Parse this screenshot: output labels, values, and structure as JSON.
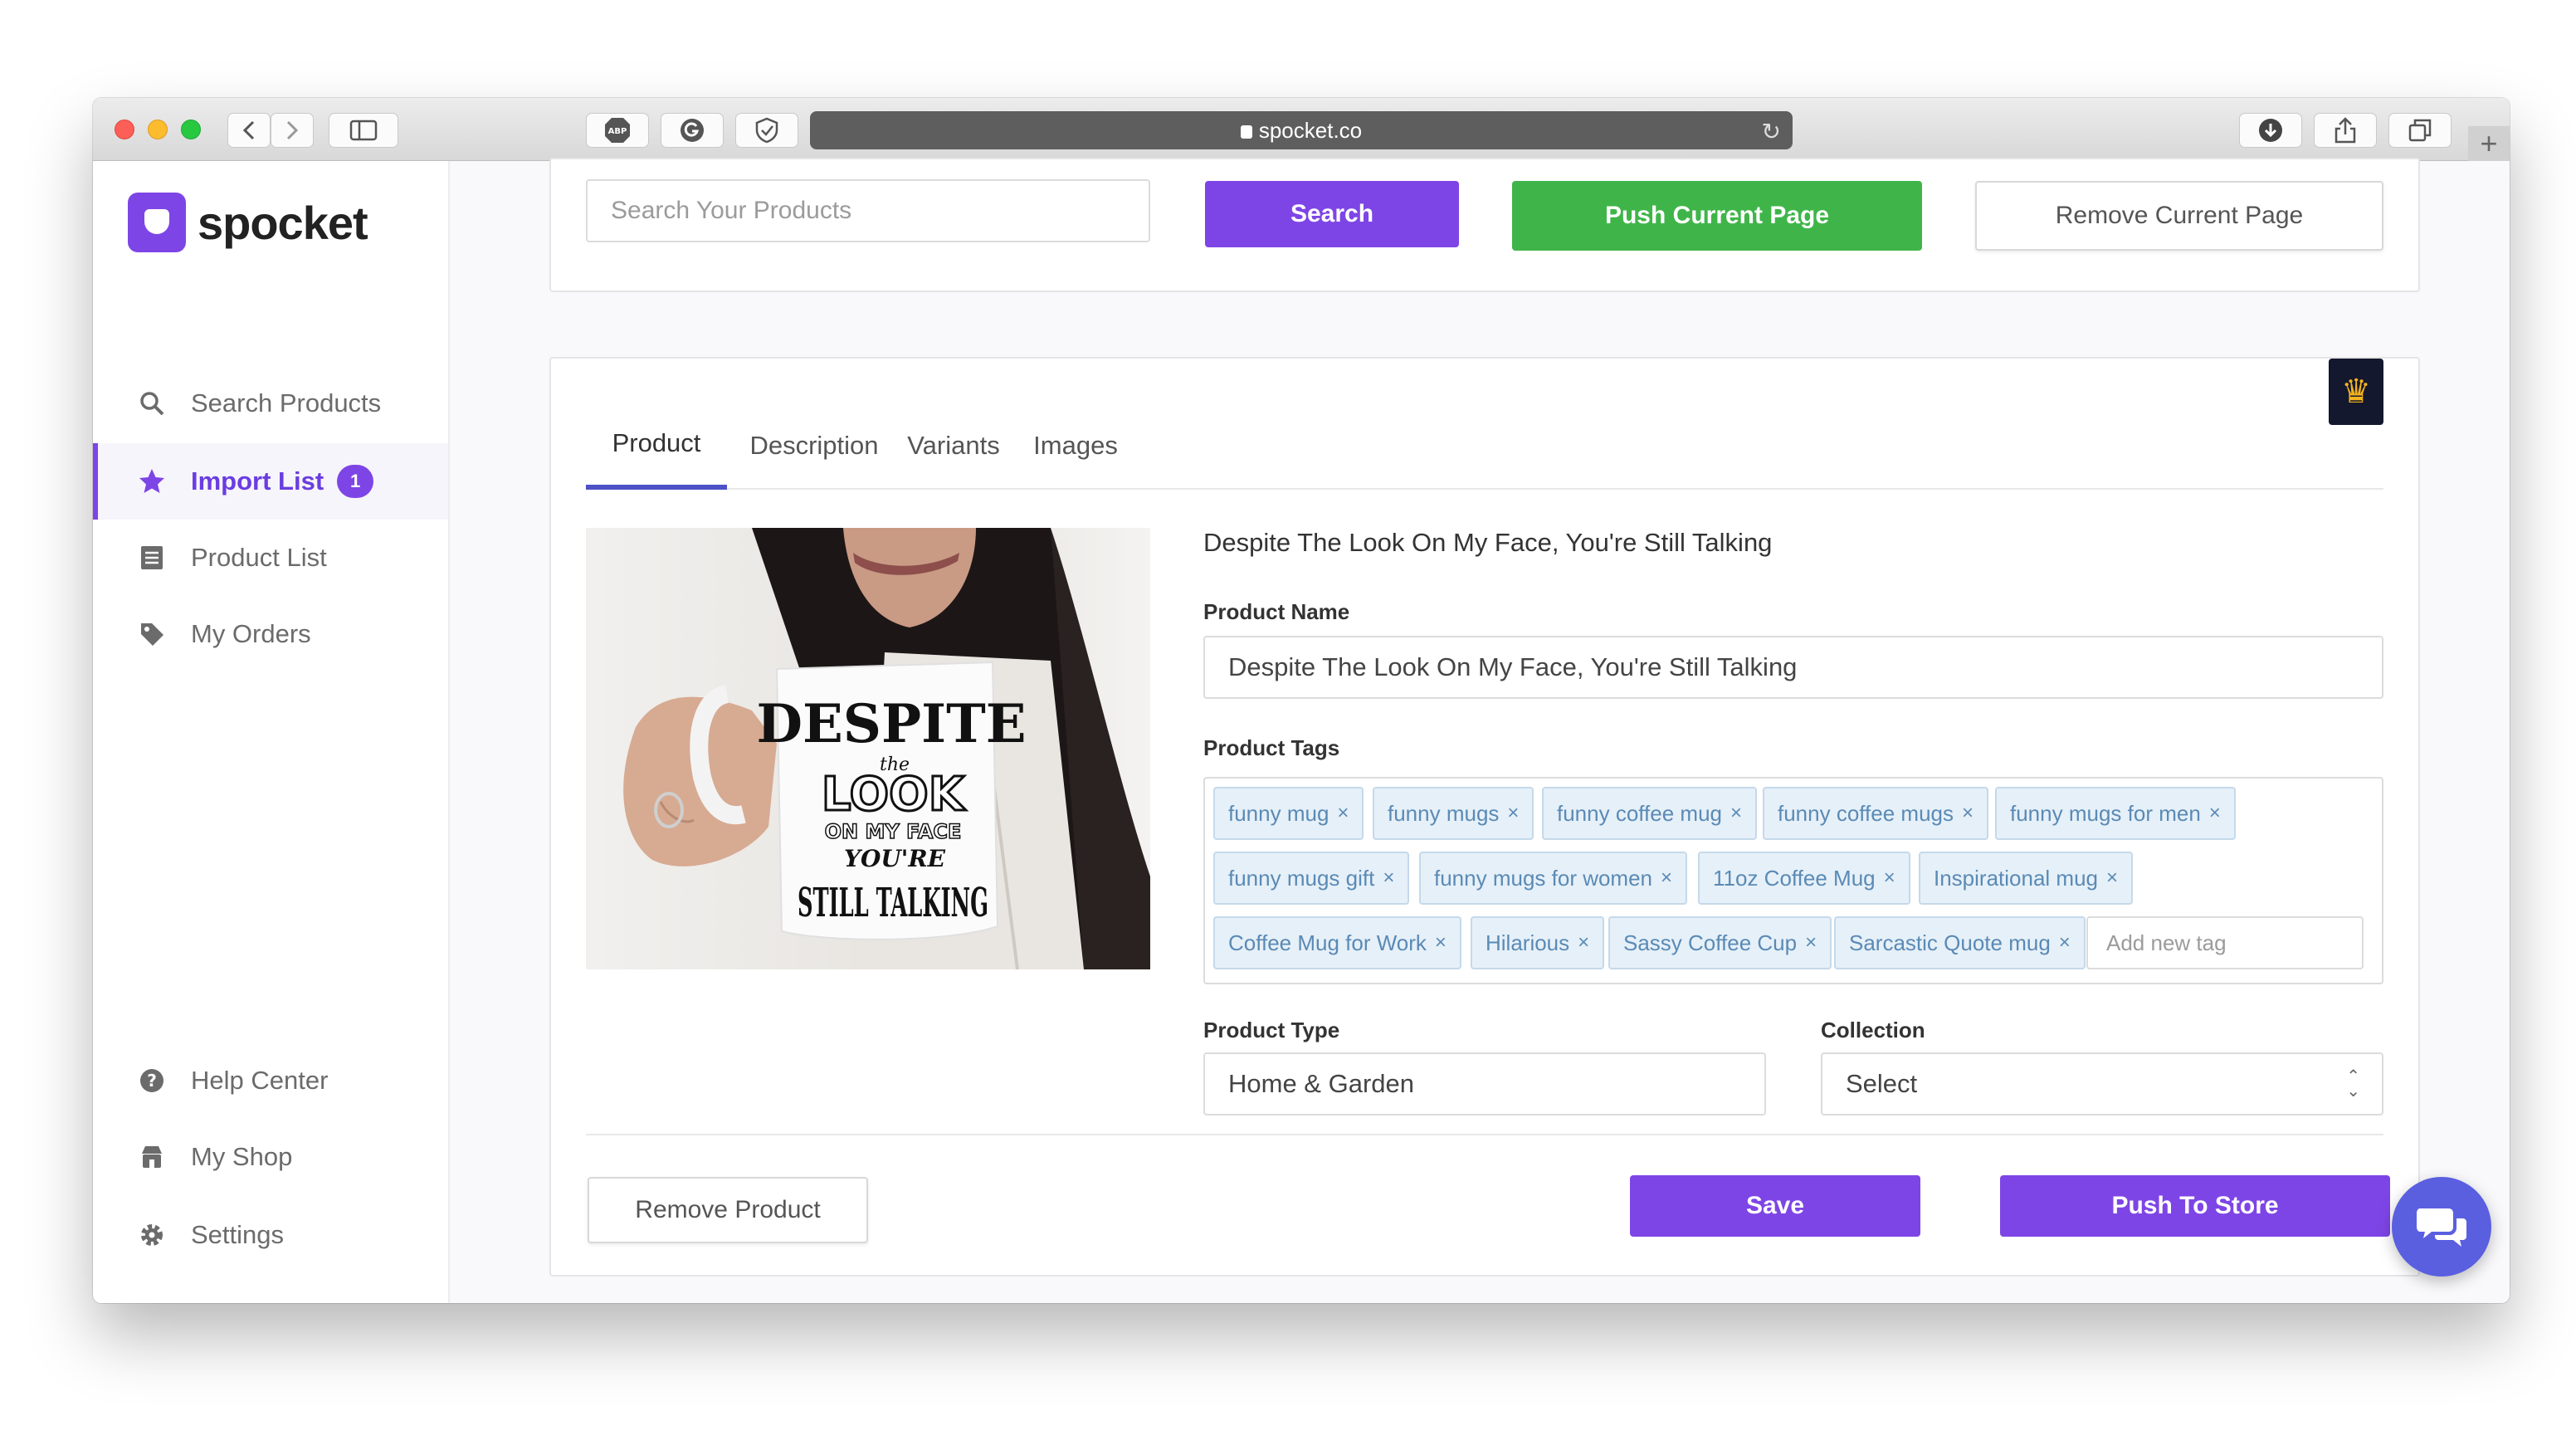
{
  "browser": {
    "url": "spocket.co"
  },
  "sidebar": {
    "logo_text": "spocket",
    "nav_items": [
      {
        "label": "Search Products",
        "icon": "search-icon"
      },
      {
        "label": "Import List",
        "icon": "star-icon",
        "badge": "1",
        "active": true
      },
      {
        "label": "Product List",
        "icon": "list-icon"
      },
      {
        "label": "My Orders",
        "icon": "tag-icon"
      }
    ],
    "bottom_items": [
      {
        "label": "Help Center",
        "icon": "help-icon"
      },
      {
        "label": "My Shop",
        "icon": "shop-icon"
      },
      {
        "label": "Settings",
        "icon": "gear-icon"
      }
    ]
  },
  "toolbar": {
    "search_placeholder": "Search Your Products",
    "search_label": "Search",
    "push_page_label": "Push Current Page",
    "remove_page_label": "Remove Current Page"
  },
  "product_card": {
    "tabs": [
      "Product",
      "Description",
      "Variants",
      "Images"
    ],
    "active_tab": "Product",
    "title": "Despite The Look On My Face, You're Still Talking",
    "product_name_label": "Product Name",
    "product_name_value": "Despite The Look On My Face, You're Still Talking",
    "product_tags_label": "Product Tags",
    "tags": [
      "funny mug",
      "funny mugs",
      "funny coffee mug",
      "funny coffee mugs",
      "funny mugs for men",
      "funny mugs gift",
      "funny mugs for women",
      "11oz Coffee Mug",
      "Inspirational mug",
      "Coffee Mug for Work",
      "Hilarious",
      "Sassy Coffee Cup",
      "Sarcastic Quote mug"
    ],
    "tag_remove_glyph": "×",
    "add_tag_placeholder": "Add new tag",
    "product_type_label": "Product Type",
    "product_type_value": "Home & Garden",
    "collection_label": "Collection",
    "collection_value": "Select",
    "mug_text": [
      "DESPITE",
      "the",
      "LOOK",
      "ON MY FACE",
      "YOU'RE",
      "STILL TALKING"
    ],
    "remove_product_label": "Remove Product",
    "save_label": "Save",
    "push_to_store_label": "Push To Store"
  },
  "colors": {
    "brand_purple": "#7e45e6",
    "push_green": "#3fb549",
    "tag_bg": "#e6f0f8",
    "tag_text": "#5a8ab5",
    "chat_blue": "#5a5fe0"
  }
}
